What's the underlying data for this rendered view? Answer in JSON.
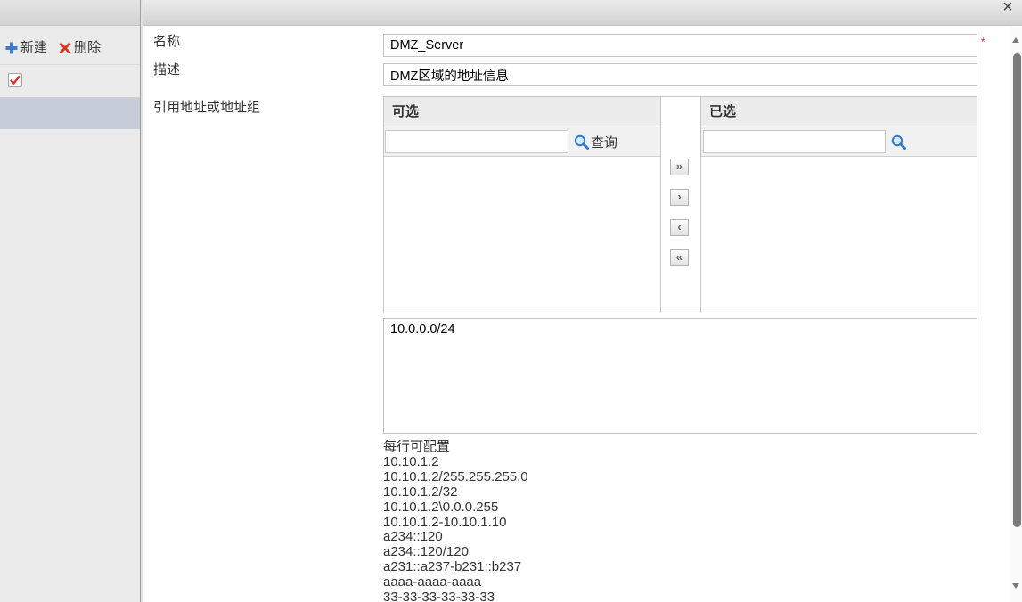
{
  "colors": {
    "plus_icon": "#3b7bd4",
    "delete_icon": "#d8342a",
    "check_mark": "#d8342a",
    "search_icon": "#3479cf",
    "required_mark": "#e02222",
    "selected_row": "#c6cdd8"
  },
  "icons": {
    "new": "plus-icon",
    "delete": "delete-x-icon",
    "checkbox": "check-icon",
    "search": "search-icon",
    "close": "close-icon"
  },
  "dialog": {
    "close_label": "×"
  },
  "sidebar": {
    "toolbar": {
      "new_label": "新建",
      "delete_label": "删除"
    },
    "rows": [
      {
        "checked": true
      },
      {
        "selected": true
      }
    ]
  },
  "form": {
    "name": {
      "label": "名称",
      "value": "DMZ_Server",
      "required_mark": "*"
    },
    "description": {
      "label": "描述",
      "value": "DMZ区域的地址信息"
    },
    "reference": {
      "label": "引用地址或地址组",
      "available": {
        "title": "可选",
        "search_value": "",
        "search_button": "查询"
      },
      "selected": {
        "title": "已选",
        "search_value": ""
      },
      "move_buttons": [
        "»",
        "›",
        "‹",
        "«"
      ]
    },
    "addresses": "10.0.0.0/24",
    "help_lines": [
      "每行可配置",
      "10.10.1.2",
      "10.10.1.2/255.255.255.0",
      "10.10.1.2/32",
      "10.10.1.2\\0.0.0.255",
      "10.10.1.2-10.10.1.10",
      "a234::120",
      "a234::120/120",
      "a231::a237-b231::b237",
      "aaaa-aaaa-aaaa",
      "33-33-33-33-33-33"
    ]
  }
}
